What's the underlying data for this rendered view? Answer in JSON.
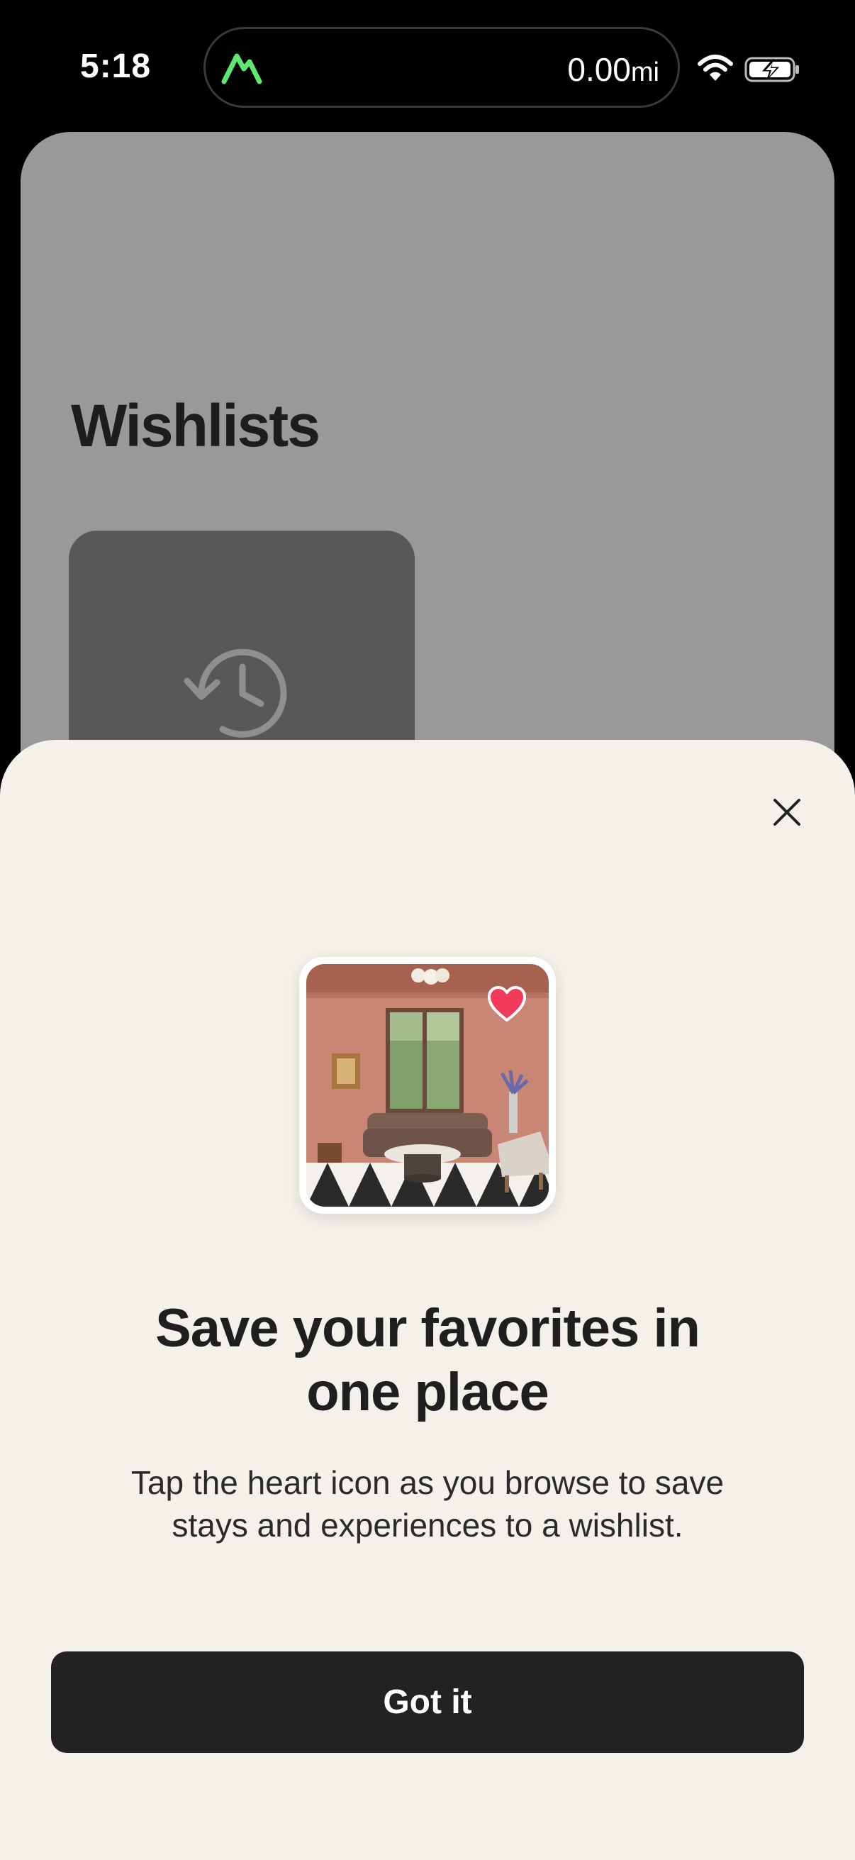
{
  "status_bar": {
    "time": "5:18",
    "distance_value": "0.00",
    "distance_unit": "mi",
    "logo_icon": "mountain-logo-icon",
    "wifi_icon": "wifi-icon",
    "battery_icon": "battery-charging-icon"
  },
  "background": {
    "title": "Wishlists",
    "card_icon": "history-icon"
  },
  "modal": {
    "close_icon": "close-icon",
    "photo_icon": "heart-icon",
    "headline_line1": "Save your favorites in",
    "headline_line2": "one place",
    "subtext_line1": "Tap the heart icon as you browse to save",
    "subtext_line2": "stays and experiences to a wishlist.",
    "button_label": "Got it"
  },
  "colors": {
    "accent_green": "#5ee86f",
    "heart_red": "#f23b5a",
    "button_bg": "#222222",
    "modal_bg": "#f4f0ea"
  }
}
